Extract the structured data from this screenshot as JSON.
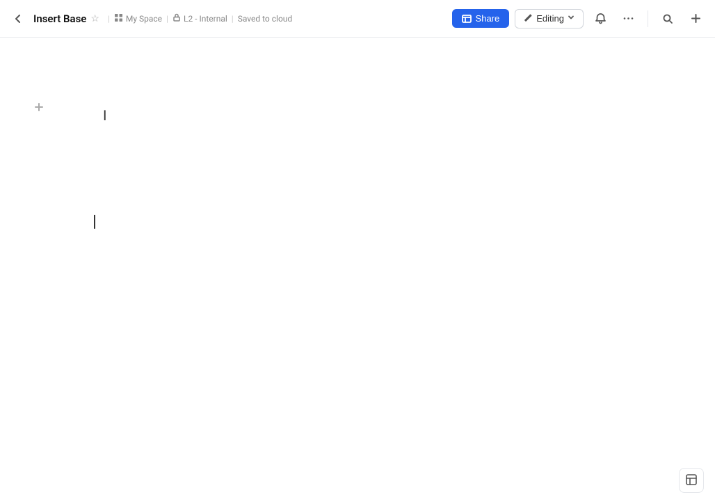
{
  "header": {
    "back_label": "‹",
    "title": "Insert Base",
    "star_icon": "☆",
    "breadcrumbs": [
      {
        "icon": "▦",
        "label": "My Space"
      },
      {
        "icon": "🔒",
        "label": "L2 - Internal"
      }
    ],
    "saved_status": "Saved to cloud",
    "share_button": "Share",
    "editing_button": "Editing",
    "bell_icon": "🔔",
    "more_icon": "•••",
    "search_icon": "🔍",
    "add_icon": "+"
  },
  "editor": {
    "add_block_icon": "+",
    "placeholder": ""
  },
  "bottom": {
    "panel_icon": "panel"
  }
}
